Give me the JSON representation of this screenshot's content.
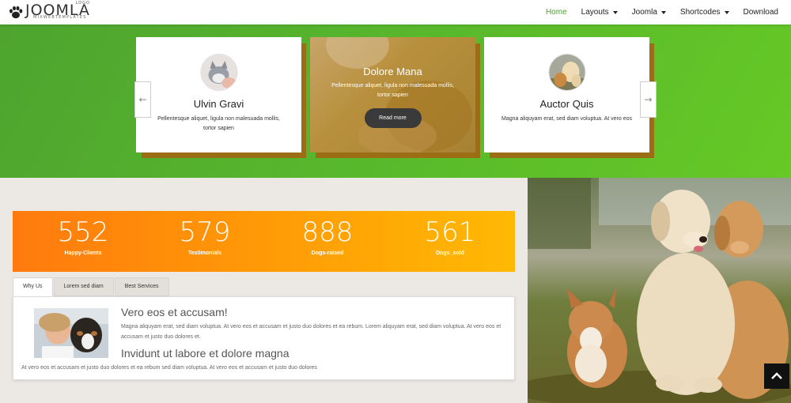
{
  "header": {
    "logo_text": "JOOMLA",
    "logo_small": "LOGO",
    "logo_sub": "MIXWEBTEMPLATES",
    "nav": [
      {
        "label": "Home",
        "active": true,
        "dropdown": false
      },
      {
        "label": "Layouts",
        "active": false,
        "dropdown": true
      },
      {
        "label": "Joomla",
        "active": false,
        "dropdown": true
      },
      {
        "label": "Shortcodes",
        "active": false,
        "dropdown": true
      },
      {
        "label": "Download",
        "active": false,
        "dropdown": false
      }
    ]
  },
  "carousel": {
    "prev_icon": "arrow-left-icon",
    "next_icon": "arrow-right-icon",
    "cards": [
      {
        "name": "Ulvin Gravi",
        "text": "Pellentesque aliquet, ligula non malesuada mollis, tortor sapien"
      },
      {
        "name": "Dolore Mana",
        "text": "Pellentesque aliquet, ligula non malesuada mollis, tortor sapien",
        "button": "Read more"
      },
      {
        "name": "Auctor Quis",
        "text": "Magna aliquyam erat, sed diam voluptua. At vero eos"
      }
    ]
  },
  "counters": [
    {
      "value": "552",
      "label": "Happy-Clients"
    },
    {
      "value": "579",
      "label": "Testimonials"
    },
    {
      "value": "888",
      "label": "Dogs-raised"
    },
    {
      "value": "561",
      "label": "Dogs_sold"
    }
  ],
  "tabs": {
    "items": [
      "Why Us",
      "Lorem sed diam",
      "Best Services"
    ],
    "active_index": 0,
    "panel": {
      "heading1": "Vero eos et accusam!",
      "paragraph1": "Magna aliquyam erat, sed diam voluptua. At vero eos et accusam et justo duo dolores et ea rebum. Lorem aliquyam erat, sed diam voluptua. At vero eos et accusam et justo duo dolores et.",
      "heading2": "Invidunt ut labore et dolore magna",
      "paragraph2": "At vero eos et accusam et justo duo dolores et ea rebum sed diam voluptua. At vero eos et accusam et justo duo dolores"
    }
  },
  "colors": {
    "accent_green": "#45a626",
    "hero_green": "#58b82c",
    "counter_orange": "#ff9a06"
  },
  "back_to_top_icon": "chevron-up-icon"
}
